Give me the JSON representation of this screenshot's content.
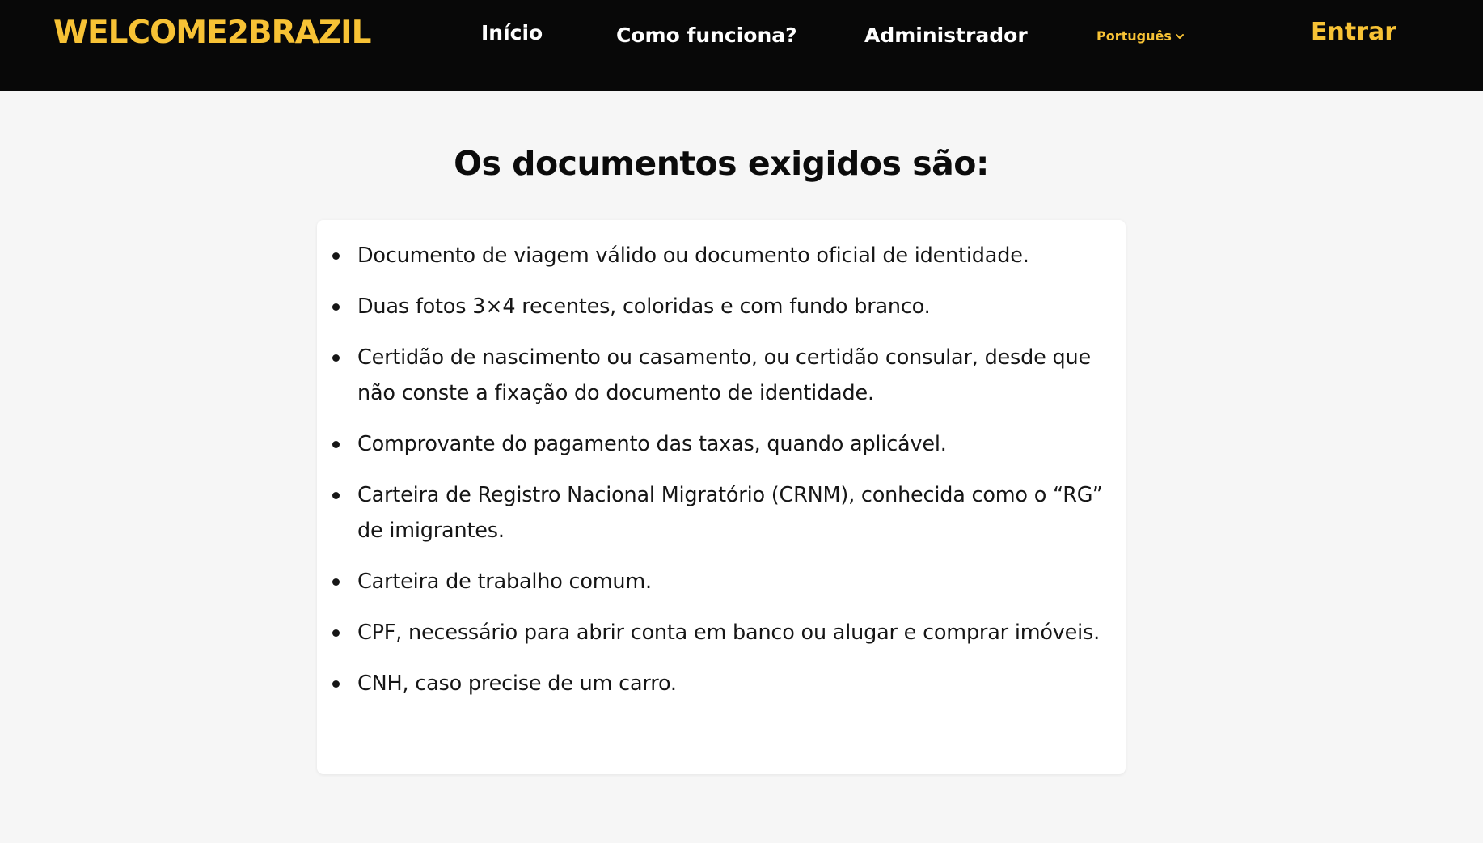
{
  "header": {
    "brand": "WELCOME2BRAZIL",
    "nav": {
      "home": "Início",
      "how_it_works": "Como funciona?",
      "admin": "Administrador"
    },
    "language": {
      "selected": "Português",
      "icon": "chevron-down-icon"
    },
    "login": "Entrar"
  },
  "main": {
    "title": "Os documentos exigidos são:",
    "documents": [
      "Documento de viagem válido ou documento oficial de identidade.",
      "Duas fotos 3×4 recentes, coloridas e com fundo branco.",
      "Certidão de nascimento ou casamento, ou certidão consular, desde que não conste a fixação do documento de identidade.",
      "Comprovante do pagamento das taxas, quando aplicável.",
      "Carteira de Registro Nacional Migratório (CRNM), conhecida como o “RG” de imigrantes.",
      "Carteira de trabalho comum.",
      "CPF, necessário para abrir conta em banco ou alugar e comprar imóveis.",
      "CNH, caso precise de um carro."
    ]
  },
  "colors": {
    "header_bg": "#080808",
    "accent": "#f7c235",
    "page_bg": "#f6f6f6",
    "card_bg": "#ffffff",
    "text": "#161616"
  }
}
